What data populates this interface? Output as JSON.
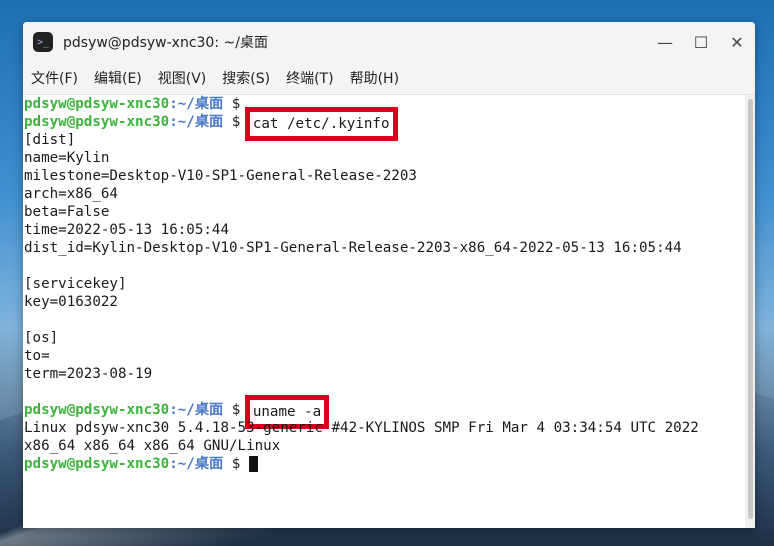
{
  "window": {
    "title": "pdsyw@pdsyw-xnc30: ~/桌面",
    "app_icon": ">_",
    "controls": {
      "minimize": "—",
      "maximize": "☐",
      "close": "✕"
    }
  },
  "menu": [
    "文件(F)",
    "编辑(E)",
    "视图(V)",
    "搜索(S)",
    "终端(T)",
    "帮助(H)"
  ],
  "terminal": {
    "prompt_user": "pdsyw@pdsyw-xnc30",
    "prompt_path": ":~/桌面",
    "prompt_symbol": " $ ",
    "command1": "cat /etc/.kyinfo",
    "command2": "uname -a",
    "output1": [
      "[dist]",
      "name=Kylin",
      "milestone=Desktop-V10-SP1-General-Release-2203",
      "arch=x86_64",
      "beta=False",
      "time=2022-05-13 16:05:44",
      "dist_id=Kylin-Desktop-V10-SP1-General-Release-2203-x86_64-2022-05-13 16:05:44",
      "",
      "[servicekey]",
      "key=0163022",
      "",
      "[os]",
      "to=",
      "term=2023-08-19",
      ""
    ],
    "output2": [
      "Linux pdsyw-xnc30 5.4.18-53-generic #42-KYLINOS SMP Fri Mar 4 03:34:54 UTC 2022",
      "x86_64 x86_64 x86_64 GNU/Linux"
    ]
  }
}
